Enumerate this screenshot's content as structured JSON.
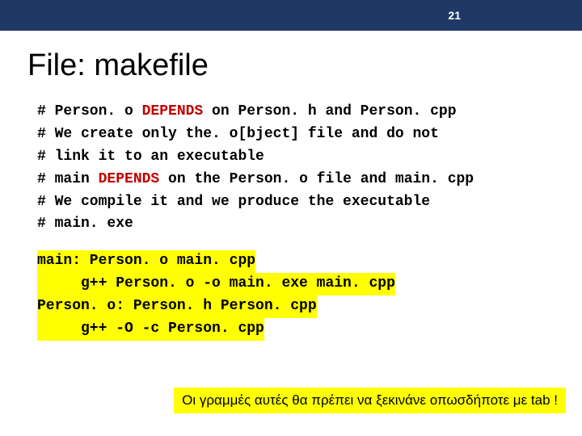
{
  "header": {
    "page_number": "21"
  },
  "title": "File: makefile",
  "code": {
    "c1a": "# Person. o ",
    "c1b": "DEPENDS",
    "c1c": " on Person. h and Person. cpp",
    "c2": "# We create only the. o[bject] file and do not",
    "c3": "# link it to an executable",
    "c4a": "# main ",
    "c4b": "DEPENDS",
    "c4c": " on the Person. o file and main. cpp",
    "c5": "# We compile it and we produce the executable",
    "c6": "# main. exe",
    "m1": "main: Person. o main. cpp",
    "m2": "     g++ Person. o -o main. exe main. cpp",
    "m3": "Person. o: Person. h Person. cpp",
    "m4": "     g++ -O -c Person. cpp"
  },
  "note": "Οι γραμμές αυτές θα πρέπει να ξεκινάνε οπωσδήποτε με tab !"
}
